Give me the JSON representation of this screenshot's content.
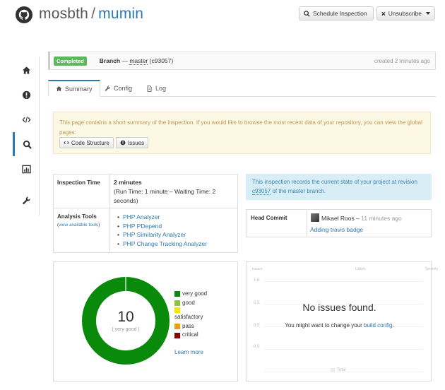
{
  "header": {
    "owner": "mosbth",
    "separator": "/",
    "repo": "mumin",
    "schedule_label": "Schedule Inspection",
    "unsubscribe_label": "Unsubscribe"
  },
  "sidebar": {
    "items": [
      {
        "icon": "home-icon"
      },
      {
        "icon": "alert-icon"
      },
      {
        "icon": "code-icon"
      },
      {
        "icon": "search-icon",
        "active": true
      },
      {
        "icon": "chart-icon"
      },
      {
        "icon": "wrench-icon"
      }
    ]
  },
  "status": {
    "badge": "Completed",
    "branch_label": "Branch",
    "branch_dash": "—",
    "branch_name": "master",
    "commit_ref": "(c93057)",
    "created": "created 2 minutes ago"
  },
  "tabs": [
    {
      "label": "Summary",
      "active": true
    },
    {
      "label": "Config"
    },
    {
      "label": "Log"
    }
  ],
  "notice": {
    "text": "This page contains a short summary of the inspection. If you would like to browse the most recent data of your repository, you can view the global pages:",
    "code_structure_label": "Code Structure",
    "issues_label": "Issues"
  },
  "info": {
    "inspection_time_label": "Inspection Time",
    "inspection_time_value": "2 minutes",
    "inspection_time_detail": "(Run Time: 1 minute – Waiting Time: 2 seconds)",
    "analysis_tools_label": "Analysis Tools",
    "view_tools_link": "view available tools",
    "tools": [
      "PHP Analyzer",
      "PHP PDepend",
      "PHP Similarity Analyzer",
      "PHP Change Tracking Analyzer"
    ]
  },
  "blue_note": {
    "text_before": "This inspection records the current state of your project at revision",
    "revision": "c93057",
    "text_after": "of the master branch."
  },
  "commit": {
    "label": "Head Commit",
    "author": "Mikael Roos",
    "dash": "–",
    "ago": "11 minutes ago",
    "message": "Adding travis badge"
  },
  "quality": {
    "score": "10",
    "rating": "( very good )",
    "legend": [
      {
        "label": "very good",
        "color": "#0a8a0a"
      },
      {
        "label": "good",
        "color": "#8cc63f"
      },
      {
        "label": "satisfactory",
        "color": "#f5e600"
      },
      {
        "label": "pass",
        "color": "#f39c12"
      },
      {
        "label": "critical",
        "color": "#8b0000"
      }
    ],
    "learn_more": "Learn more",
    "ring_color": "#0a8a0a"
  },
  "issues_chart": {
    "header_issues": "Issues",
    "header_labels": "Labels",
    "header_severity": "Severity",
    "ticks": [
      "1.0",
      "0.5",
      "0.0",
      "-0.5",
      "-1.0"
    ],
    "empty_title": "No issues found.",
    "empty_sub_before": "You might want to change your",
    "empty_sub_link": "build config",
    "empty_sub_after": ".",
    "total_label": "Total"
  }
}
